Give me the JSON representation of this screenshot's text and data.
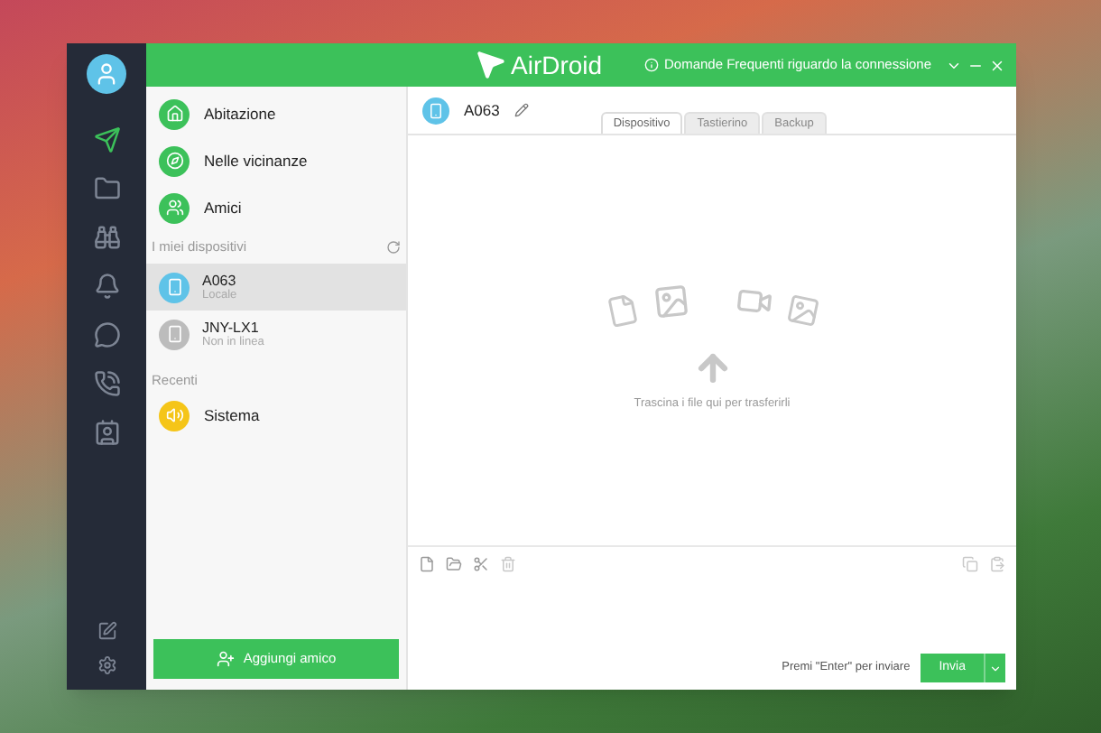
{
  "header": {
    "logo_text": "AirDroid",
    "faq_link": "Domande Frequenti riguardo la connessione"
  },
  "nav_icons": [
    {
      "kind": "send",
      "selected": true
    },
    {
      "kind": "folder",
      "selected": false
    },
    {
      "kind": "binoculars",
      "selected": false
    },
    {
      "kind": "bell",
      "selected": false
    },
    {
      "kind": "chat",
      "selected": false
    },
    {
      "kind": "phone",
      "selected": false
    },
    {
      "kind": "contact",
      "selected": false
    }
  ],
  "places": [
    {
      "label": "Abitazione",
      "kind": "home"
    },
    {
      "label": "Nelle vicinanze",
      "kind": "compass"
    },
    {
      "label": "Amici",
      "kind": "friends"
    }
  ],
  "devices_heading": "I miei dispositivi",
  "devices": [
    {
      "name": "A063",
      "status": "Locale",
      "online": true,
      "selected": true
    },
    {
      "name": "JNY-LX1",
      "status": "Non in linea",
      "online": false,
      "selected": false
    }
  ],
  "recent_heading": "Recenti",
  "recent": [
    {
      "label": "Sistema"
    }
  ],
  "add_friend_button": "Aggiungi amico",
  "device_title": "A063",
  "tabs": [
    {
      "label": "Dispositivo",
      "selected": true
    },
    {
      "label": "Tastierino",
      "selected": false
    },
    {
      "label": "Backup",
      "selected": false
    }
  ],
  "drop_hint": "Trascina i file qui per trasferirli",
  "send_hint": "Premi \"Enter\" per inviare",
  "send_button": "Invia"
}
